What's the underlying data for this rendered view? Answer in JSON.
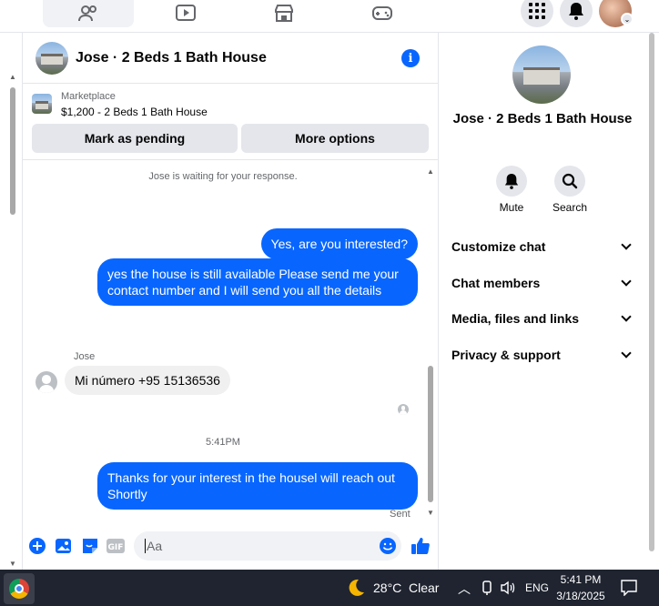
{
  "chat": {
    "title": "Jose · 2 Beds 1 Bath House",
    "marketplace_label": "Marketplace",
    "listing": "$1,200 - 2 Beds 1 Bath House",
    "mark_pending": "Mark as pending",
    "more_options": "More options",
    "waiting": "Jose is waiting for your response.",
    "messages": [
      {
        "from": "me",
        "text": "Yes, are you interested?"
      },
      {
        "from": "me",
        "text": "yes  the house is still available Please send me your contact number and I will send you all the details"
      },
      {
        "from": "Jose",
        "text": "Mi número +95 15136536"
      },
      {
        "from": "me",
        "text": "Thanks for your interest in the housel will reach out Shortly"
      }
    ],
    "sender_name": "Jose",
    "time_separator": "5:41PM",
    "sent_label": "Sent",
    "input_placeholder": "Aa"
  },
  "info_panel": {
    "name": "Jose · 2 Beds 1 Bath House",
    "mute": "Mute",
    "search": "Search",
    "sections": [
      "Customize chat",
      "Chat members",
      "Media, files and links",
      "Privacy & support"
    ]
  },
  "taskbar": {
    "temperature": "28°C",
    "weather": "Clear",
    "language": "ENG",
    "time": "5:41 PM",
    "date": "3/18/2025"
  },
  "colors": {
    "accent": "#0866ff",
    "bubble_in": "#f0f0f0",
    "taskbar": "#1f2430"
  }
}
